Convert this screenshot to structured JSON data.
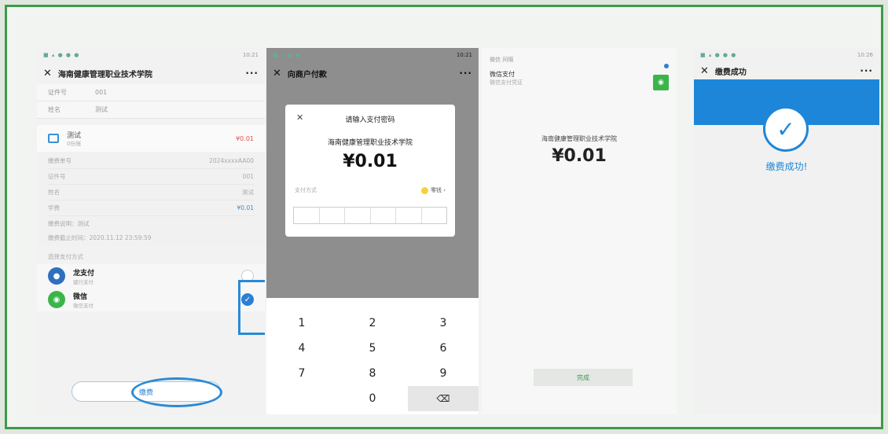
{
  "phone1": {
    "status": "10:21",
    "title": "海南健康管理职业技术学院",
    "more": "···",
    "rows": [
      {
        "k": "证件号",
        "v": "001"
      },
      {
        "k": "姓名",
        "v": "测试"
      }
    ],
    "item": {
      "name": "测试",
      "sub": "0份账",
      "amount": "¥0.01"
    },
    "details": [
      {
        "k": "缴费单号",
        "v": "2024xxxxAA00"
      },
      {
        "k": "证件号",
        "v": "001"
      },
      {
        "k": "姓名",
        "v": "测试"
      },
      {
        "k": "学费",
        "v": "¥0.01"
      }
    ],
    "note1": "缴费说明：测试",
    "note2": "缴费截止时间：2020.11.12 23:59:59",
    "section": "选择支付方式",
    "pay1": {
      "name": "龙支付",
      "sub": "建行支付"
    },
    "pay2": {
      "name": "微信",
      "sub": "微信支付"
    },
    "button": "缴费"
  },
  "phone2": {
    "status": "10:21",
    "title": "向商户付款",
    "more": "···",
    "modal_title": "请输入支付密码",
    "org": "海南健康管理职业技术学院",
    "amount": "¥0.01",
    "method_label": "支付方式",
    "method_value": "零钱 ›",
    "keys": [
      "1",
      "2",
      "3",
      "4",
      "5",
      "6",
      "7",
      "8",
      "9",
      "0"
    ],
    "delete": "⌫"
  },
  "phone3": {
    "app": "微信 间隔",
    "line1": "微信支付",
    "line2": "微信支付凭证",
    "org": "海南健康管理职业技术学院",
    "amount": "¥0.01",
    "done": "完成"
  },
  "phone4": {
    "status": "10:26",
    "title": "缴费成功",
    "more": "···",
    "success": "缴费成功!"
  }
}
